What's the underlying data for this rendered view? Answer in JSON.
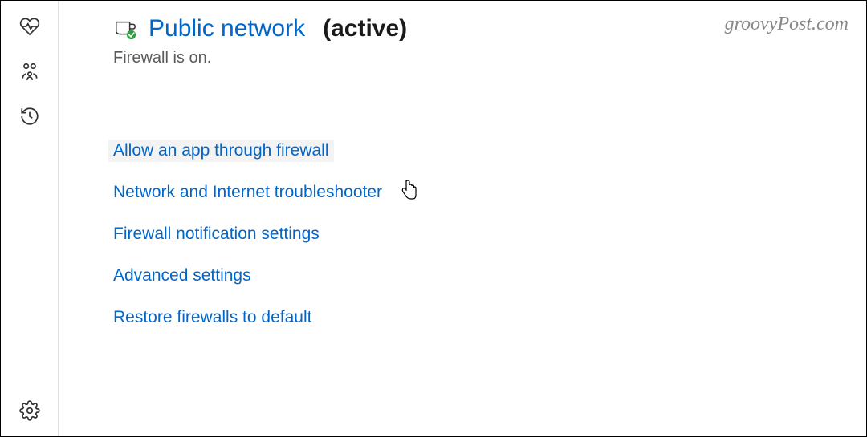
{
  "sidebar": {
    "icons": [
      {
        "name": "device-performance-icon"
      },
      {
        "name": "family-options-icon"
      },
      {
        "name": "protection-history-icon"
      }
    ],
    "bottom_icon": {
      "name": "settings-icon"
    }
  },
  "header": {
    "title": "Public network",
    "active_suffix": "(active)",
    "status": "Firewall is on."
  },
  "links": [
    {
      "label": "Allow an app through firewall",
      "hover": true
    },
    {
      "label": "Network and Internet troubleshooter",
      "hover": false
    },
    {
      "label": "Firewall notification settings",
      "hover": false
    },
    {
      "label": "Advanced settings",
      "hover": false
    },
    {
      "label": "Restore firewalls to default",
      "hover": false
    }
  ],
  "watermark": "groovyPost.com",
  "colors": {
    "link": "#0066cc",
    "text": "#5a5a5a",
    "title": "#1a1a1a"
  }
}
